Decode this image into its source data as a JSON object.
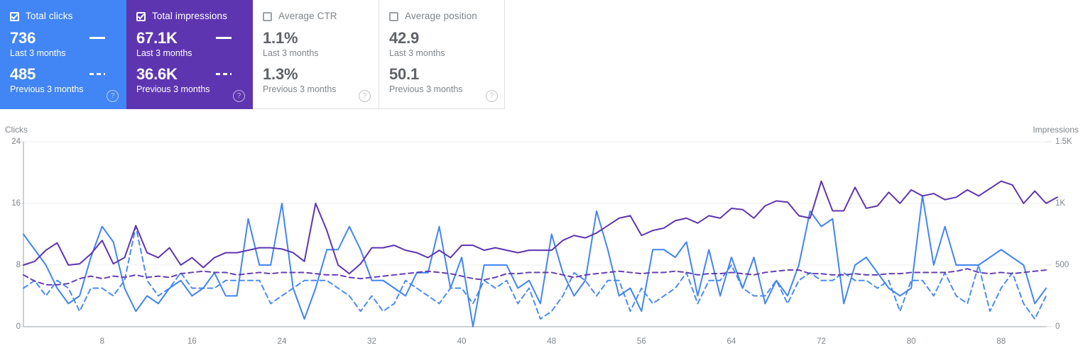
{
  "metrics": [
    {
      "id": "total-clicks",
      "label": "Total clicks",
      "checked": true,
      "state": "active",
      "color": "#4285f4",
      "current_value": "736",
      "current_period": "Last 3 months",
      "previous_value": "485",
      "previous_period": "Previous 3 months",
      "help": "?"
    },
    {
      "id": "total-impressions",
      "label": "Total impressions",
      "checked": true,
      "state": "active",
      "color": "#5e35b1",
      "current_value": "67.1K",
      "current_period": "Last 3 months",
      "previous_value": "36.6K",
      "previous_period": "Previous 3 months",
      "help": "?"
    },
    {
      "id": "average-ctr",
      "label": "Average CTR",
      "checked": false,
      "state": "inactive",
      "color": "#ffffff",
      "current_value": "1.1%",
      "current_period": "Last 3 months",
      "previous_value": "1.3%",
      "previous_period": "Previous 3 months",
      "help": "?"
    },
    {
      "id": "average-position",
      "label": "Average position",
      "checked": false,
      "state": "inactive",
      "color": "#ffffff",
      "current_value": "42.9",
      "current_period": "Last 3 months",
      "previous_value": "50.1",
      "previous_period": "Previous 3 months",
      "help": "?"
    }
  ],
  "chart_data": {
    "type": "line",
    "title": "",
    "xlabel": "",
    "ylabel": "Clicks",
    "y2label": "Impressions",
    "grid": true,
    "legend": "in-metric-cards",
    "x": [
      1,
      2,
      3,
      4,
      5,
      6,
      7,
      8,
      9,
      10,
      11,
      12,
      13,
      14,
      15,
      16,
      17,
      18,
      19,
      20,
      21,
      22,
      23,
      24,
      25,
      26,
      27,
      28,
      29,
      30,
      31,
      32,
      33,
      34,
      35,
      36,
      37,
      38,
      39,
      40,
      41,
      42,
      43,
      44,
      45,
      46,
      47,
      48,
      49,
      50,
      51,
      52,
      53,
      54,
      55,
      56,
      57,
      58,
      59,
      60,
      61,
      62,
      63,
      64,
      65,
      66,
      67,
      68,
      69,
      70,
      71,
      72,
      73,
      74,
      75,
      76,
      77,
      78,
      79,
      80,
      81,
      82,
      83,
      84,
      85,
      86,
      87,
      88,
      89,
      90,
      91,
      92
    ],
    "xticks": [
      8,
      16,
      24,
      32,
      40,
      48,
      56,
      64,
      72,
      80,
      88
    ],
    "yticks_left": [
      0,
      8,
      16,
      24
    ],
    "ylim_left": [
      0,
      24
    ],
    "yticks_right": [
      "0",
      "500",
      "1K",
      "1.5K"
    ],
    "ylim_right": [
      0,
      1500
    ],
    "series": [
      {
        "name": "Total clicks",
        "period": "Last 3 months",
        "axis": "left",
        "color": "#4285f4",
        "style": "solid",
        "values": [
          12,
          10,
          8,
          5,
          3,
          4,
          9,
          13,
          11,
          5,
          2,
          4,
          3,
          5,
          6,
          4,
          5,
          7,
          4,
          4,
          14,
          8,
          8,
          16,
          5,
          1,
          5,
          10,
          10,
          13,
          10,
          6,
          6,
          5,
          4,
          7,
          7,
          13,
          5,
          9,
          0,
          8,
          8,
          8,
          5,
          6,
          3,
          12,
          7,
          4,
          6,
          15,
          10,
          4,
          5,
          2,
          10,
          10,
          9,
          11,
          4,
          10,
          4,
          9,
          5,
          9,
          3,
          6,
          4,
          8,
          15,
          13,
          14,
          3,
          8,
          9,
          7,
          5,
          4,
          5,
          17,
          8,
          13,
          8,
          8,
          8,
          9,
          10,
          9,
          8,
          3,
          5
        ]
      },
      {
        "name": "Total clicks",
        "period": "Previous 3 months",
        "axis": "left",
        "color": "#4285f4",
        "style": "dashed",
        "values": [
          5,
          6,
          4,
          6,
          5,
          2,
          5,
          5,
          4,
          6,
          13,
          6,
          4,
          5,
          7,
          5,
          5,
          5,
          6,
          6,
          6,
          6,
          3,
          4,
          5,
          6,
          6,
          6,
          5,
          4,
          2,
          4,
          2,
          3,
          6,
          5,
          4,
          3,
          5,
          5,
          3,
          6,
          5,
          6,
          3,
          5,
          1,
          2,
          4,
          7,
          6,
          4,
          6,
          6,
          2,
          5,
          3,
          4,
          5,
          7,
          3,
          6,
          6,
          8,
          5,
          4,
          4,
          6,
          3,
          6,
          7,
          6,
          6,
          7,
          6,
          6,
          5,
          6,
          2,
          6,
          6,
          4,
          7,
          4,
          3,
          8,
          2,
          5,
          7,
          3,
          1,
          4
        ]
      },
      {
        "name": "Total impressions",
        "period": "Last 3 months",
        "axis": "right",
        "color": "#5e35b1",
        "style": "solid",
        "values": [
          500,
          530,
          620,
          680,
          500,
          510,
          590,
          700,
          510,
          560,
          820,
          600,
          560,
          640,
          500,
          560,
          480,
          560,
          600,
          600,
          620,
          640,
          640,
          630,
          600,
          530,
          1000,
          780,
          500,
          430,
          510,
          640,
          640,
          660,
          620,
          600,
          560,
          620,
          560,
          660,
          660,
          620,
          640,
          620,
          600,
          620,
          620,
          620,
          700,
          740,
          720,
          760,
          820,
          880,
          900,
          740,
          780,
          800,
          860,
          880,
          840,
          900,
          880,
          960,
          950,
          880,
          980,
          1020,
          1010,
          900,
          880,
          1180,
          940,
          940,
          1130,
          960,
          980,
          1090,
          1000,
          1110,
          1060,
          1080,
          1030,
          1050,
          1110,
          1060,
          1120,
          1180,
          1150,
          1000,
          1100,
          1000,
          1050
        ]
      },
      {
        "name": "Total impressions",
        "period": "Previous 3 months",
        "axis": "right",
        "color": "#5e35b1",
        "style": "dashed",
        "values": [
          420,
          370,
          340,
          340,
          350,
          390,
          410,
          390,
          410,
          400,
          420,
          400,
          410,
          400,
          430,
          440,
          450,
          440,
          440,
          420,
          430,
          440,
          430,
          440,
          440,
          440,
          430,
          420,
          420,
          400,
          390,
          400,
          410,
          420,
          430,
          440,
          450,
          440,
          430,
          410,
          390,
          380,
          400,
          430,
          430,
          440,
          440,
          440,
          420,
          400,
          420,
          430,
          440,
          450,
          440,
          430,
          440,
          440,
          450,
          440,
          420,
          430,
          430,
          440,
          430,
          420,
          440,
          450,
          460,
          460,
          430,
          430,
          420,
          420,
          430,
          420,
          420,
          430,
          430,
          440,
          440,
          440,
          440,
          450,
          470,
          440,
          430,
          440,
          430,
          440,
          450,
          460
        ]
      }
    ]
  }
}
